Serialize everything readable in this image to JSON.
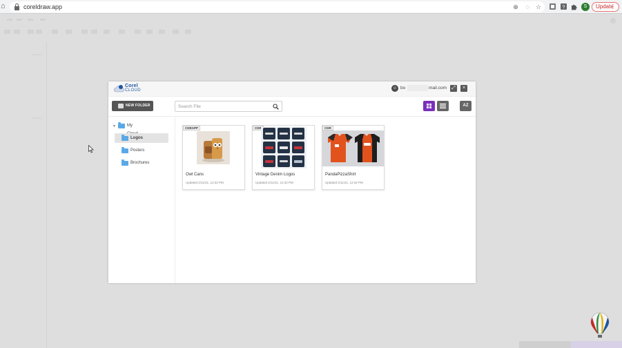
{
  "browser": {
    "url": "coreldraw.app",
    "update_label": "Update",
    "profile_initial": "S"
  },
  "dialog": {
    "brand_name": "Corel",
    "brand_sub": "CLOUD",
    "user_email_start": "bo",
    "user_email_end": "mail.com",
    "new_folder_label": "NEW FOLDER",
    "search_placeholder": "Search File",
    "sort_label": "AZ",
    "accent_color": "#7b2fbe"
  },
  "folders": {
    "root": "My Cloud",
    "items": [
      {
        "label": "Logos",
        "selected": true
      },
      {
        "label": "Posters",
        "selected": false
      },
      {
        "label": "Brochures",
        "selected": false
      }
    ]
  },
  "files": [
    {
      "badge": "CDRAPP",
      "title": "Owl Cans",
      "updated": "Updated 2/11/21, 12:32 PM"
    },
    {
      "badge": "CDR",
      "title": "Vintage Denim Logos",
      "updated": "Updated 2/11/21, 12:32 PM"
    },
    {
      "badge": "CDR",
      "title": "PandaPizzaShirt",
      "updated": "Updated 2/11/21, 12:32 PM"
    }
  ]
}
